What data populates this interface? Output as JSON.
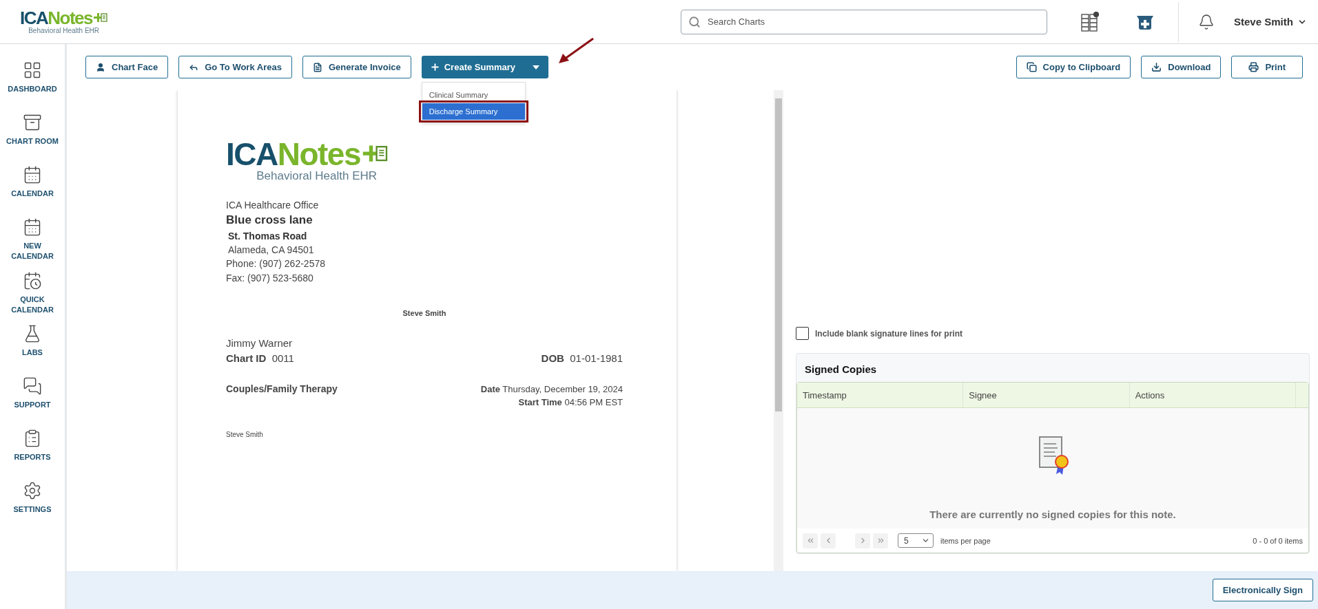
{
  "header": {
    "logo": {
      "name_dark": "ICA",
      "name_green": "Notes",
      "tagline": "Behavioral Health EHR"
    },
    "search": {
      "placeholder": "Search Charts"
    },
    "user": {
      "name": "Steve Smith"
    }
  },
  "sidebar": {
    "items": [
      {
        "label": "DASHBOARD"
      },
      {
        "label": "CHART ROOM"
      },
      {
        "label": "CALENDAR"
      },
      {
        "label": "NEW\nCALENDAR"
      },
      {
        "label": "QUICK\nCALENDAR"
      },
      {
        "label": "LABS"
      },
      {
        "label": "SUPPORT"
      },
      {
        "label": "REPORTS"
      },
      {
        "label": "SETTINGS"
      }
    ]
  },
  "toolbar": {
    "buttons": [
      {
        "label": "Chart Face"
      },
      {
        "label": "Go To Work Areas"
      },
      {
        "label": "Generate Invoice"
      }
    ],
    "create_summary": {
      "label": "Create Summary",
      "menu": [
        {
          "label": "Clinical Summary",
          "selected": false
        },
        {
          "label": "Discharge Summary",
          "selected": true
        }
      ]
    },
    "right_buttons": [
      {
        "label": "Copy to Clipboard"
      },
      {
        "label": "Download"
      },
      {
        "label": "Print"
      }
    ]
  },
  "document": {
    "logo": {
      "name_dark": "ICA",
      "name_green": "Notes",
      "tagline": "Behavioral Health EHR"
    },
    "office": "ICA Healthcare Office",
    "address_lines": [
      {
        "kind": "heading",
        "text": "Blue cross lane"
      },
      {
        "kind": "bold",
        "text": "St. Thomas Road"
      },
      {
        "kind": "plain",
        "text": "Alameda, CA 94501"
      }
    ],
    "contact_lines": [
      "Phone: (907) 262-2578",
      "Fax: (907) 523-5680"
    ],
    "provider": "Steve Smith",
    "patient": "Jimmy Warner",
    "chart_id": {
      "label": "Chart ID",
      "value": "0011"
    },
    "dob": {
      "label": "DOB",
      "value": "01-01-1981"
    },
    "service": "Couples/Family Therapy",
    "date": {
      "label": "Date",
      "value": "Thursday, December 19, 2024"
    },
    "start_time": {
      "label": "Start Time",
      "value": "04:56 PM EST"
    },
    "signature": "Steve Smith"
  },
  "signature_option": {
    "label": "Include blank signature lines for print",
    "checked": false
  },
  "signed_copies": {
    "title": "Signed Copies",
    "columns": [
      "Timestamp",
      "Signee",
      "Actions"
    ],
    "empty_message": "There are currently no signed copies for this note.",
    "page_size": "5",
    "page_size_label": "items per page",
    "range": "0 - 0 of 0 items"
  },
  "footer": {
    "button": "Electronically Sign"
  }
}
